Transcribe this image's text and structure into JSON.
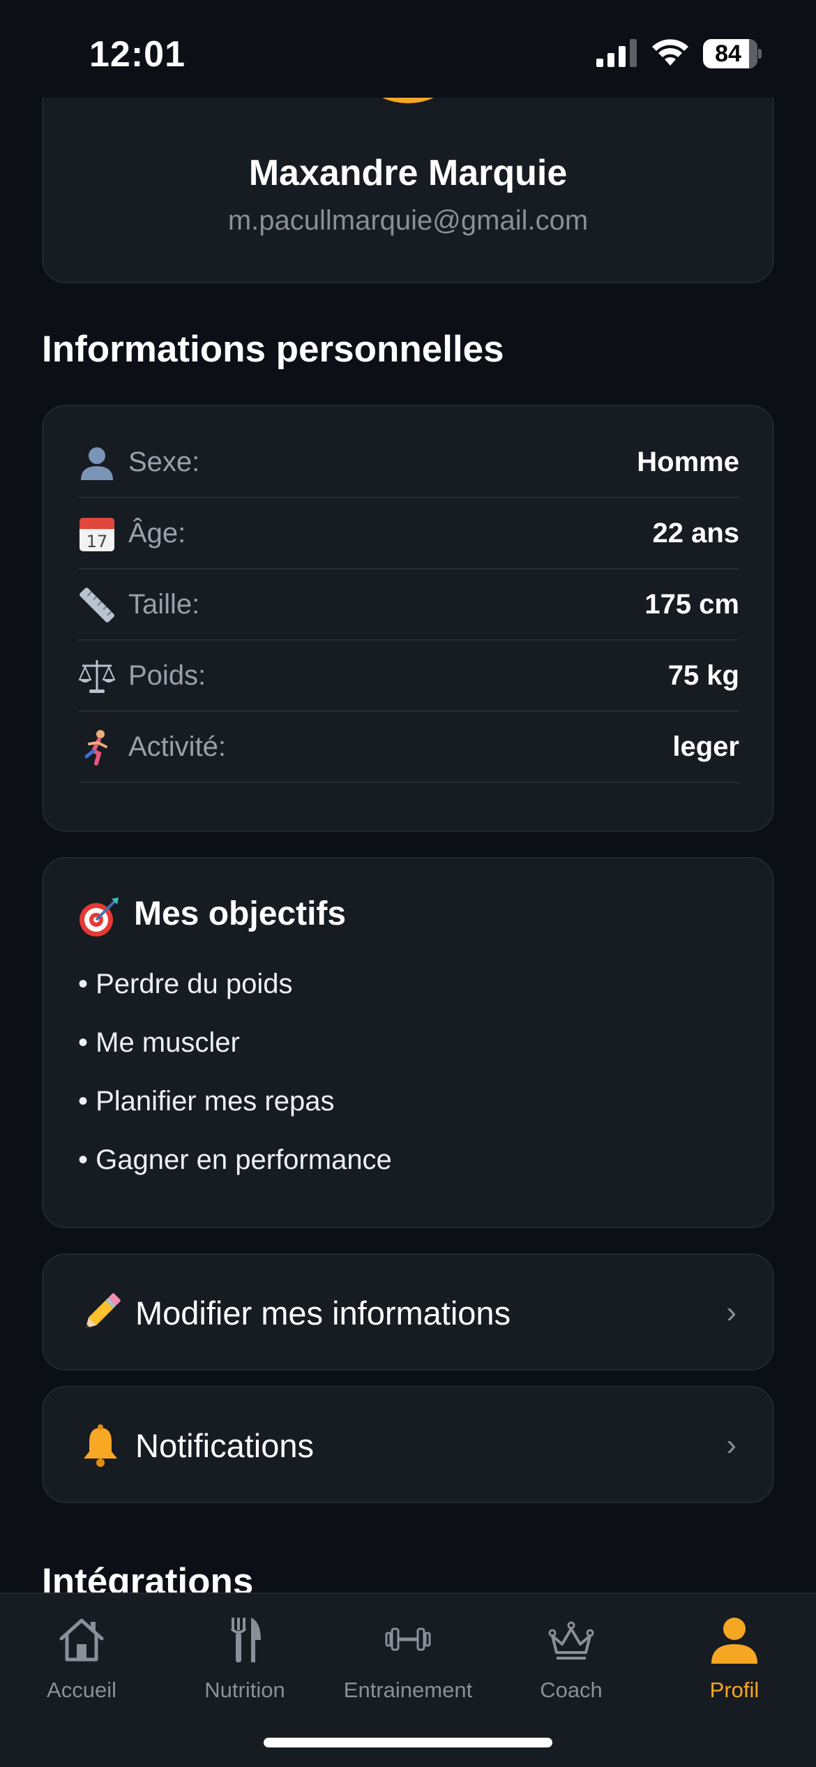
{
  "status_bar": {
    "time": "12:01",
    "battery": "84"
  },
  "profile": {
    "name": "Maxandre Marquie",
    "email": "m.pacullmarquie@gmail.com"
  },
  "personal_info": {
    "title": "Informations personnelles",
    "rows": [
      {
        "icon": "person-icon",
        "label": "Sexe:",
        "value": "Homme"
      },
      {
        "icon": "calendar-icon",
        "label": "Âge:",
        "value": "22 ans"
      },
      {
        "icon": "ruler-icon",
        "label": "Taille:",
        "value": "175 cm"
      },
      {
        "icon": "scale-icon",
        "label": "Poids:",
        "value": "75 kg"
      },
      {
        "icon": "runner-icon",
        "label": "Activité:",
        "value": "leger"
      }
    ]
  },
  "goals": {
    "title": "Mes objectifs",
    "icon": "target-icon",
    "items": [
      "• Perdre du poids",
      "• Me muscler",
      "• Planifier mes repas",
      "• Gagner en performance"
    ]
  },
  "menu": [
    {
      "icon": "pencil-icon",
      "label": "Modifier mes informations"
    },
    {
      "icon": "bell-icon",
      "label": "Notifications"
    }
  ],
  "integrations_title": "Intégrations",
  "tabs": [
    {
      "icon": "home-icon",
      "label": "Accueil"
    },
    {
      "icon": "cutlery-icon",
      "label": "Nutrition"
    },
    {
      "icon": "dumbbell-icon",
      "label": "Entrainement"
    },
    {
      "icon": "crown-icon",
      "label": "Coach"
    },
    {
      "icon": "profile-icon",
      "label": "Profil",
      "active": true
    }
  ],
  "colors": {
    "accent": "#f5a623",
    "background": "#0c1016",
    "card": "#171b22",
    "muted": "#8a8f99"
  }
}
